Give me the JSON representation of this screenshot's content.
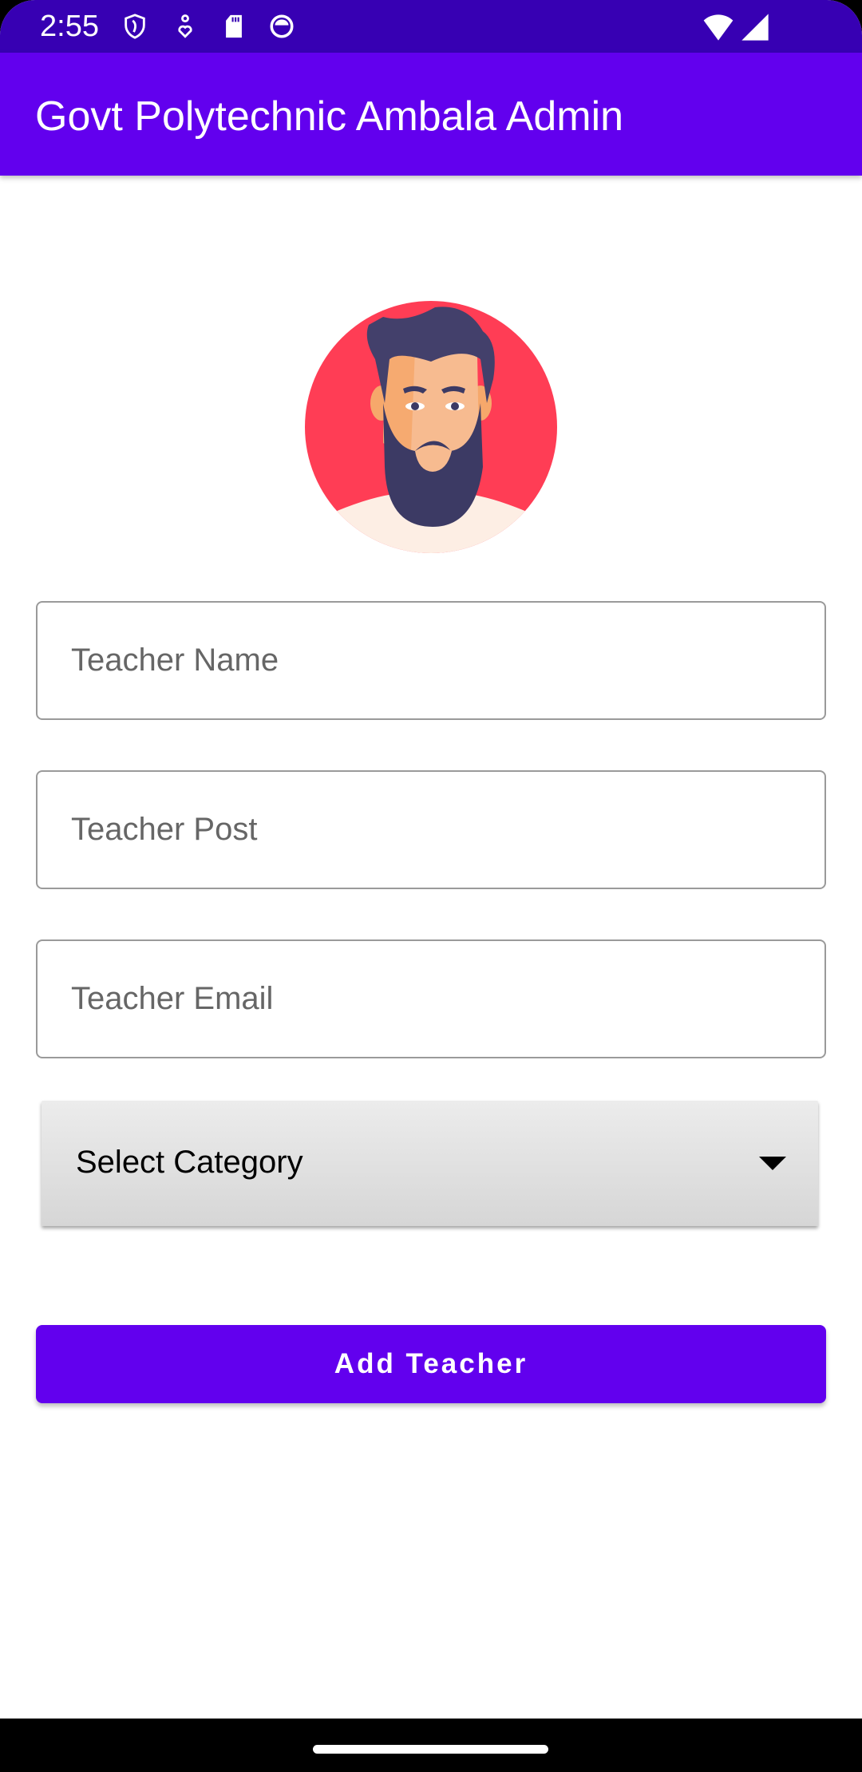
{
  "status_bar": {
    "time": "2:55",
    "icons": [
      "shield-icon",
      "accessibility-icon",
      "sd-card-icon",
      "android-debug-icon",
      "wifi-icon",
      "signal-icon"
    ]
  },
  "app_bar": {
    "title": "Govt Polytechnic Ambala Admin"
  },
  "form": {
    "name_placeholder": "Teacher Name",
    "post_placeholder": "Teacher Post",
    "email_placeholder": "Teacher Email",
    "category_selected": "Select Category",
    "submit_label": "Add Teacher"
  },
  "colors": {
    "primary": "#6200ee",
    "primary_dark": "#3700b3",
    "avatar_bg": "#ff3d55"
  }
}
